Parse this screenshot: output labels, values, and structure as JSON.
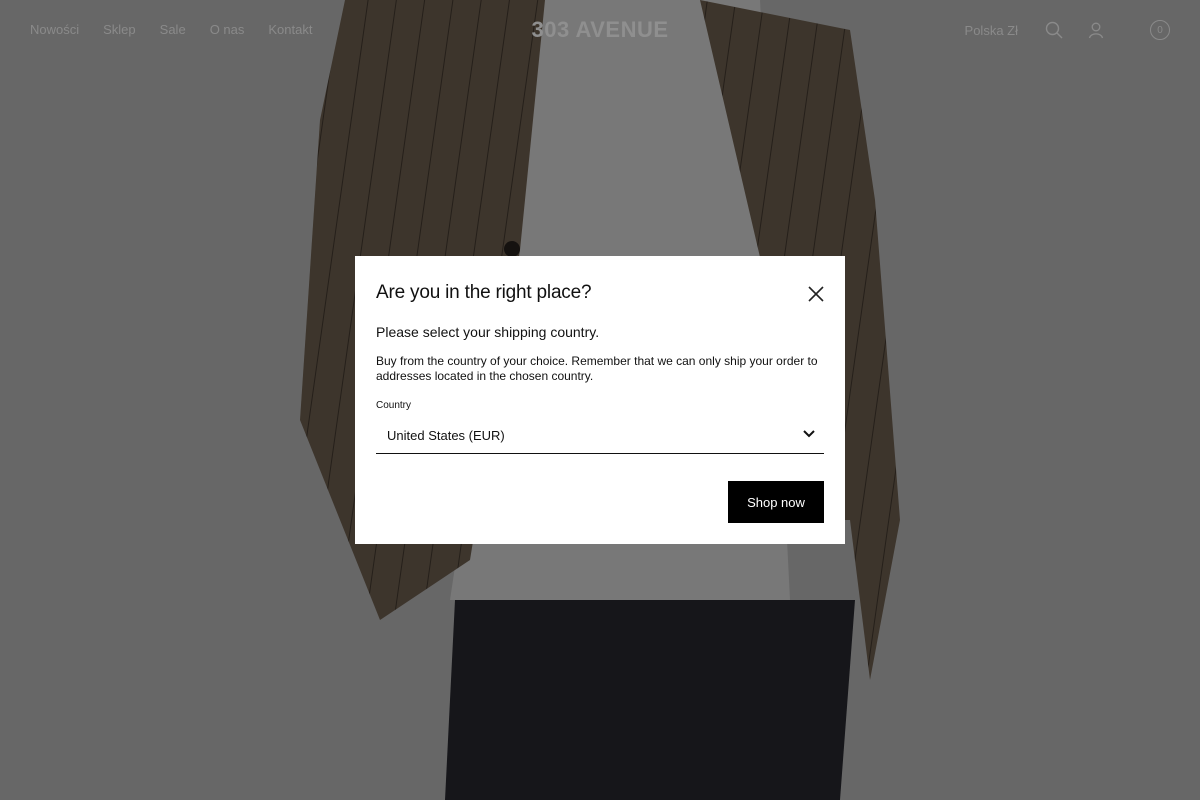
{
  "header": {
    "nav": [
      "Nowości",
      "Sklep",
      "Sale",
      "O nas",
      "Kontakt"
    ],
    "logo": "303 AVENUE",
    "locale": "Polska  Zł",
    "cart_count": "0",
    "icons": [
      "search-icon",
      "account-icon",
      "cart-icon"
    ]
  },
  "modal": {
    "title": "Are you in the right place?",
    "subtitle": "Please select your shipping country.",
    "description": "Buy from the country of your choice. Remember that we can only ship your order to addresses located in the chosen country.",
    "country_label": "Country",
    "country_value": "United States (EUR)",
    "button_label": "Shop now"
  },
  "colors": {
    "overlay": "#000000",
    "button_bg": "#000000",
    "modal_bg": "#ffffff"
  }
}
